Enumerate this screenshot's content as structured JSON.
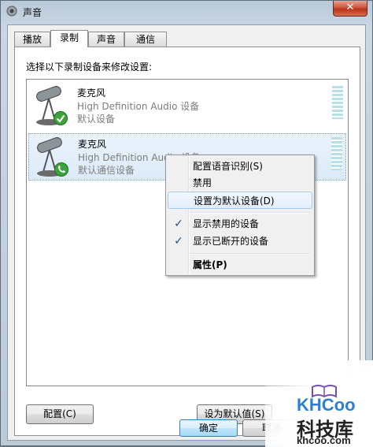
{
  "window": {
    "title": "声音",
    "close_glyph": "✕",
    "close_icon": "close-icon"
  },
  "tabs": [
    {
      "label": "播放"
    },
    {
      "label": "录制",
      "active": true
    },
    {
      "label": "声音"
    },
    {
      "label": "通信"
    }
  ],
  "panel": {
    "instruction": "选择以下录制设备来修改设置:",
    "devices": [
      {
        "name": "麦克风",
        "driver": "High Definition Audio 设备",
        "status": "默认设备",
        "badge": "green-check-icon"
      },
      {
        "name": "麦克风",
        "driver": "High Definition Audio 设备",
        "status": "默认通信设备",
        "badge": "green-phone-icon",
        "selected": true
      }
    ]
  },
  "context_menu": {
    "items": [
      {
        "label": "配置语音识别(S)",
        "type": "item"
      },
      {
        "label": "禁用",
        "type": "item"
      },
      {
        "label": "设置为默认设备(D)",
        "type": "item",
        "highlighted": true
      },
      {
        "type": "separator"
      },
      {
        "label": "显示禁用的设备",
        "type": "check",
        "checked": true
      },
      {
        "label": "显示已断开的设备",
        "type": "check",
        "checked": true
      },
      {
        "type": "separator"
      },
      {
        "label": "属性(P)",
        "type": "item",
        "bold": true
      }
    ],
    "check_glyph": "✓"
  },
  "buttons": {
    "configure": "配置(C)",
    "set_default": "设为默认值(S)",
    "ok": "确定",
    "cancel": "取消"
  },
  "watermark": {
    "logo": "KHCoo",
    "cn": "科技库",
    "url": "khcoo.com"
  },
  "colors": {
    "selection": "#dceaf8",
    "level_meter": "#b7e1e6",
    "check_badge": "#3da43d"
  }
}
